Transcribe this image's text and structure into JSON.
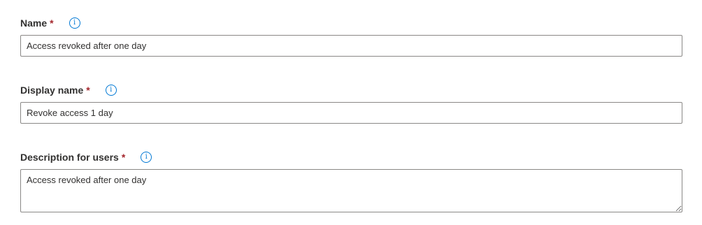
{
  "fields": {
    "name": {
      "label": "Name",
      "required_mark": "*",
      "value": "Access revoked after one day"
    },
    "display_name": {
      "label": "Display name",
      "required_mark": "*",
      "value": "Revoke access 1 day"
    },
    "description": {
      "label": "Description for users",
      "required_mark": "*",
      "value": "Access revoked after one day"
    }
  },
  "icons": {
    "info": "info-icon",
    "info_glyph": "i"
  },
  "colors": {
    "accent": "#0078d4",
    "required": "#a4262c",
    "border": "#8a8886",
    "text": "#323130"
  }
}
